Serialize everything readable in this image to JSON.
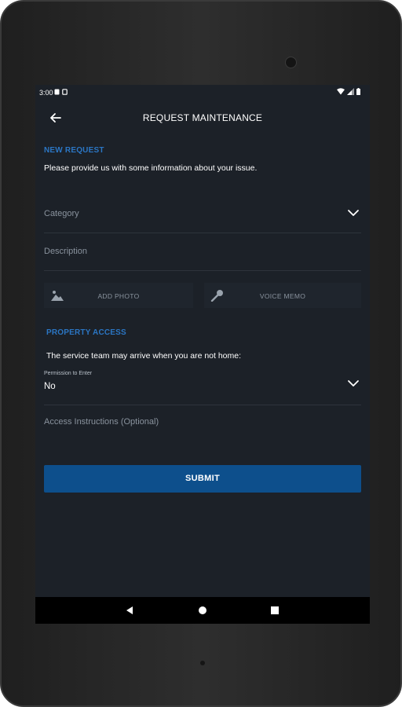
{
  "status": {
    "time": "3:00",
    "icons": [
      "notification-icon",
      "sim-icon",
      "wifi-icon",
      "signal-icon",
      "battery-icon"
    ]
  },
  "appbar": {
    "title": "REQUEST MAINTENANCE",
    "back_icon": "arrow-back-icon"
  },
  "new_request": {
    "section_label": "NEW REQUEST",
    "intro": "Please provide us with some information about your issue.",
    "category_placeholder": "Category",
    "description_placeholder": "Description",
    "add_photo_label": "ADD PHOTO",
    "voice_memo_label": "VOICE MEMO"
  },
  "property_access": {
    "section_label": "PROPERTY ACCESS",
    "note": "The service team may arrive when you are not home:",
    "permission_label": "Permission to Enter",
    "permission_value": "No",
    "instructions_placeholder": "Access Instructions (Optional)"
  },
  "submit_label": "SUBMIT",
  "colors": {
    "accent": "#2b76c4",
    "button": "#0d4f8c",
    "background": "#1c2128"
  }
}
